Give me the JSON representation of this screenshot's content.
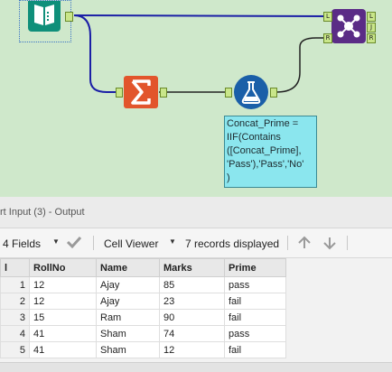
{
  "canvas": {
    "background": "#cfe8cb",
    "wire_color": "#1b1fa6",
    "anchors": {
      "join_left": "L",
      "join_right": "R",
      "union_left": "L",
      "union_join": "J",
      "union_right": "R"
    },
    "annotation": {
      "lines": [
        "Concat_Prime =",
        "IIF(Contains",
        "([Concat_Prime],",
        "'Pass'),'Pass','No'",
        ")"
      ]
    }
  },
  "results": {
    "window_title": "rt Input (3) - Output",
    "toolbar": {
      "fields_label": "4 Fields",
      "viewer_label": "Cell Viewer",
      "records_label": "7 records displayed"
    },
    "table": {
      "rownum_header": "l",
      "columns": [
        "RollNo",
        "Name",
        "Marks",
        "Prime"
      ],
      "rows": [
        {
          "n": "1",
          "cells": [
            "12",
            "Ajay",
            "85",
            "pass"
          ]
        },
        {
          "n": "2",
          "cells": [
            "12",
            "Ajay",
            "23",
            "fail"
          ]
        },
        {
          "n": "3",
          "cells": [
            "15",
            "Ram",
            "90",
            "fail"
          ]
        },
        {
          "n": "4",
          "cells": [
            "41",
            "Sham",
            "74",
            "pass"
          ]
        },
        {
          "n": "5",
          "cells": [
            "41",
            "Sham",
            "12",
            "fail"
          ]
        }
      ]
    }
  }
}
